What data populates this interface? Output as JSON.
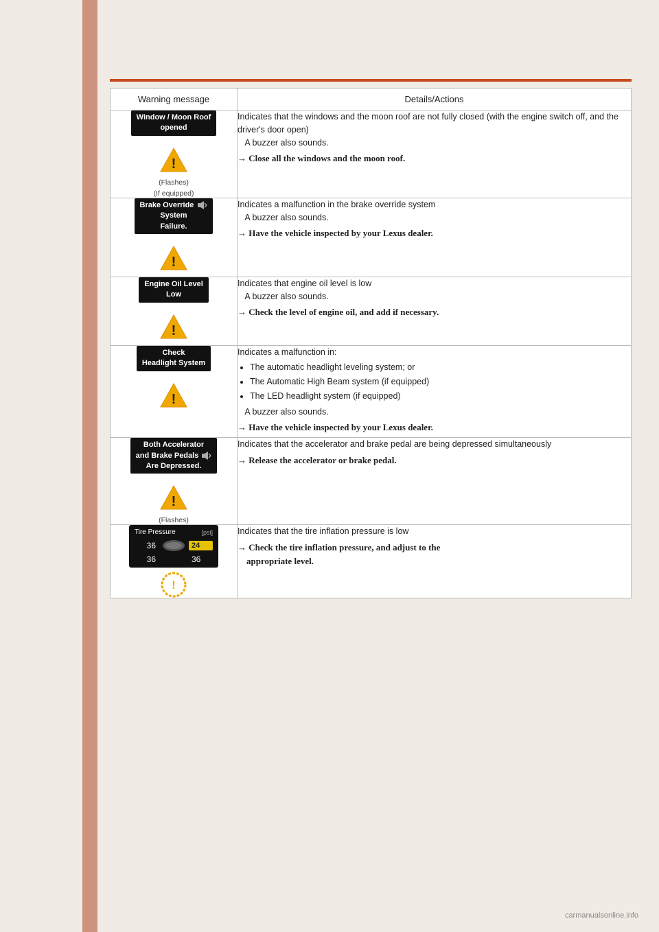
{
  "page": {
    "background_color": "#f0ebe4",
    "accent_color": "#c84b20"
  },
  "table": {
    "col1_header": "Warning message",
    "col2_header": "Details/Actions",
    "rows": [
      {
        "id": "window-moonroof",
        "warning_label": "Window / Moon Roof\nopened",
        "sub_labels": [
          "(Flashes)",
          "(If equipped)"
        ],
        "has_triangle_icon": true,
        "details_lines": [
          "Indicates that the windows and the moon roof are not",
          "fully closed (with the engine switch off, and the driver's",
          "door open)",
          "   A buzzer also sounds."
        ],
        "action_text": "→ Close all the windows and the moon roof."
      },
      {
        "id": "brake-override",
        "warning_label": "Brake Override\nSystem\nFailure.",
        "sub_labels": [],
        "has_triangle_icon": true,
        "has_speaker": true,
        "details_lines": [
          "Indicates a malfunction in the brake override system",
          "   A buzzer also sounds."
        ],
        "action_text": "→ Have the vehicle inspected by your Lexus dealer."
      },
      {
        "id": "engine-oil",
        "warning_label": "Engine Oil Level\nLow",
        "sub_labels": [],
        "has_triangle_icon": true,
        "details_lines": [
          "Indicates that engine oil level is low",
          "   A buzzer also sounds."
        ],
        "action_text": "→ Check the level of engine oil, and add if necessary."
      },
      {
        "id": "check-headlight",
        "warning_label": "Check\nHeadlight System",
        "sub_labels": [],
        "has_triangle_icon": true,
        "details_intro": "Indicates a malfunction in:",
        "details_bullets": [
          "The automatic headlight leveling system; or",
          "The Automatic High Beam system (if equipped)",
          "The LED headlight system (if equipped)"
        ],
        "details_after_bullets": "   A buzzer also sounds.",
        "action_text": "→ Have the vehicle inspected by your Lexus dealer."
      },
      {
        "id": "accelerator-brake",
        "warning_label": "Both Accelerator\nand Brake Pedals\nAre Depressed.",
        "sub_labels": [
          "(Flashes)"
        ],
        "has_triangle_icon": true,
        "has_speaker": true,
        "details_lines": [
          "Indicates that the accelerator and brake pedal are being",
          "depressed simultaneously"
        ],
        "action_text": "→ Release the accelerator or brake pedal."
      },
      {
        "id": "tire-pressure",
        "warning_label": "Tire Pressure  [psi]",
        "tire_values": {
          "top_left": "36",
          "top_right_highlight": "24",
          "bottom_left": "36",
          "bottom_right": "36"
        },
        "sub_labels": [],
        "has_tire_icon": true,
        "details_lines": [
          "Indicates that the tire inflation pressure is low"
        ],
        "action_text": "→ Check the tire inflation pressure, and adjust to the\n   appropriate level."
      }
    ]
  },
  "footer": {
    "url": "carmanualsonline.info"
  }
}
